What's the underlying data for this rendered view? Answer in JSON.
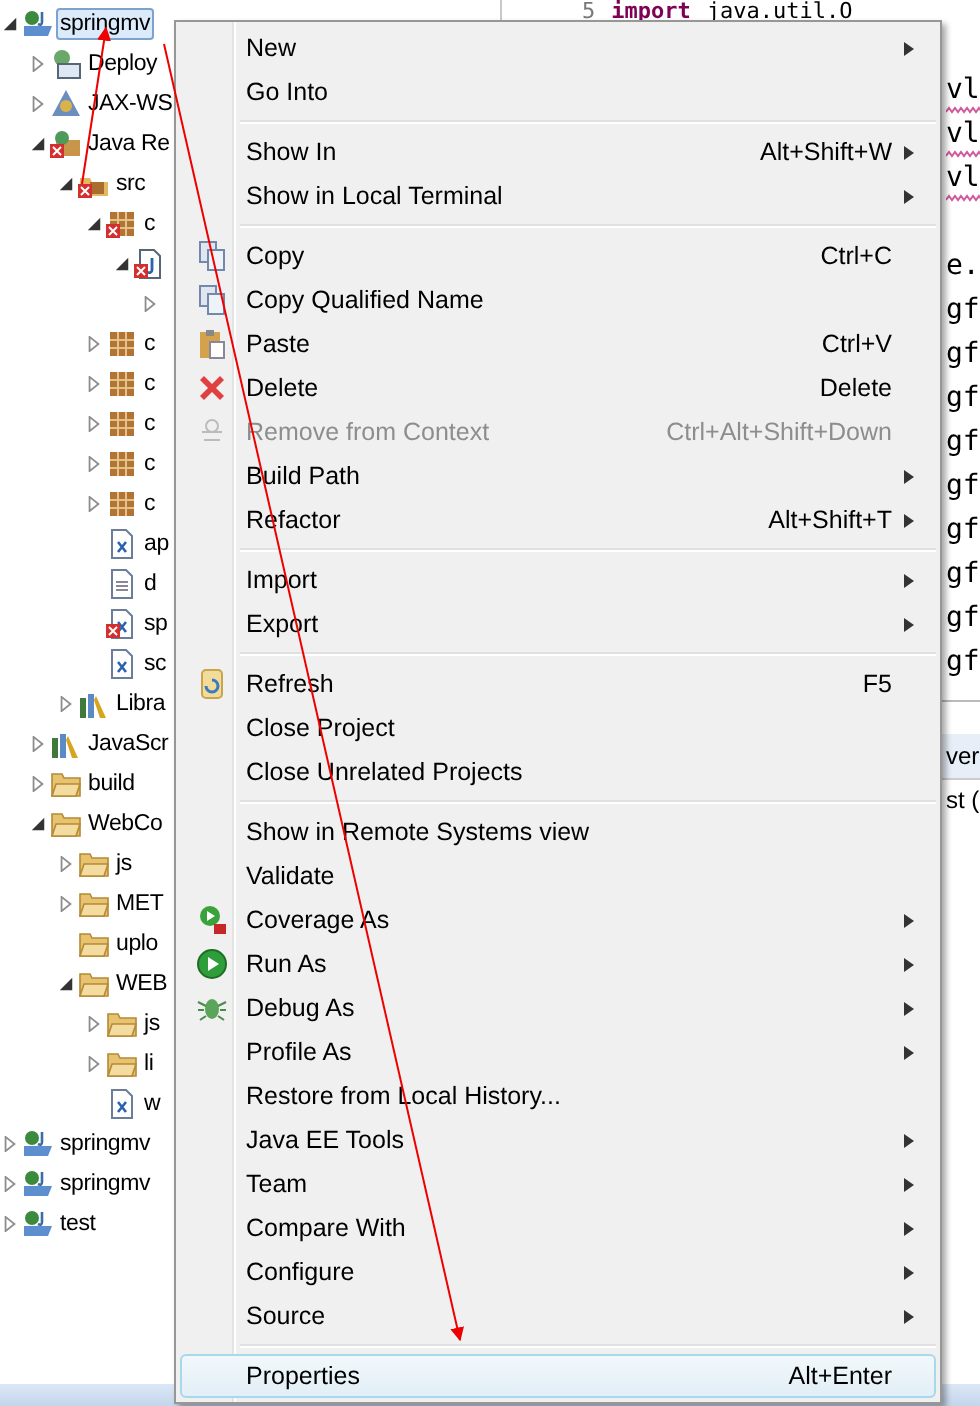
{
  "project_tree": [
    {
      "label": "springmv",
      "kind": "project",
      "selected": true,
      "expanded": true,
      "children": [
        {
          "label": "Deploy",
          "kind": "deploy",
          "selected": false,
          "expanded": false
        },
        {
          "label": "JAX-WS",
          "kind": "webservice",
          "selected": false,
          "expanded": false
        },
        {
          "label": "Java Re",
          "kind": "resources",
          "error": true,
          "selected": false,
          "expanded": true,
          "children": [
            {
              "label": "src",
              "kind": "source-folder",
              "error": true,
              "selected": false,
              "expanded": true,
              "children": [
                {
                  "label": "c",
                  "kind": "package",
                  "error": true,
                  "selected": false,
                  "expanded": true,
                  "children": [
                    {
                      "kind": "java",
                      "error": true,
                      "expanded": true,
                      "children": [
                        {
                          "expanded": false
                        }
                      ]
                    }
                  ]
                },
                {
                  "label": "c",
                  "kind": "package",
                  "selected": false,
                  "expanded": false
                },
                {
                  "label": "c",
                  "kind": "package",
                  "selected": false,
                  "expanded": false
                },
                {
                  "label": "c",
                  "kind": "package",
                  "selected": false,
                  "expanded": false
                },
                {
                  "label": "c",
                  "kind": "package",
                  "selected": false,
                  "expanded": false
                },
                {
                  "label": "c",
                  "kind": "package",
                  "selected": false,
                  "expanded": false
                },
                {
                  "label": "ap",
                  "kind": "xml",
                  "selected": false
                },
                {
                  "label": "d",
                  "kind": "file",
                  "selected": false
                },
                {
                  "label": "sp",
                  "kind": "xml",
                  "error": true,
                  "selected": false
                },
                {
                  "label": "sc",
                  "kind": "xml",
                  "selected": false
                }
              ]
            },
            {
              "label": "Libra",
              "kind": "library",
              "selected": false,
              "expanded": false
            }
          ]
        },
        {
          "label": "JavaScr",
          "kind": "library",
          "selected": false,
          "expanded": false
        },
        {
          "label": "build",
          "kind": "folder",
          "selected": false,
          "expanded": false
        },
        {
          "label": "WebCo",
          "kind": "folder",
          "selected": false,
          "expanded": true,
          "children": [
            {
              "label": "js",
              "kind": "folder",
              "selected": false,
              "expanded": false
            },
            {
              "label": "MET",
              "kind": "folder",
              "selected": false,
              "expanded": false
            },
            {
              "label": "uplo",
              "kind": "folder",
              "selected": false
            },
            {
              "label": "WEB",
              "kind": "folder",
              "selected": false,
              "expanded": true,
              "children": [
                {
                  "label": "js",
                  "kind": "folder",
                  "selected": false,
                  "expanded": false
                },
                {
                  "label": "li",
                  "kind": "folder",
                  "selected": false,
                  "expanded": false
                },
                {
                  "label": "w",
                  "kind": "xml",
                  "selected": false
                }
              ]
            }
          ]
        }
      ]
    },
    {
      "label": "springmv",
      "kind": "project",
      "selected": false,
      "expanded": false
    },
    {
      "label": "springmv",
      "kind": "project",
      "selected": false,
      "expanded": false
    },
    {
      "label": "test",
      "kind": "project",
      "selected": false,
      "expanded": false
    }
  ],
  "editor": {
    "top_line": {
      "number": "5",
      "keyword": "import",
      "text": "java.util.O"
    },
    "lines": [
      {
        "kind": "blank"
      },
      {
        "kind": "code",
        "text": "vl",
        "warning": true
      },
      {
        "kind": "code",
        "text": "vl",
        "warning": true
      },
      {
        "kind": "code",
        "text": "vl",
        "warning": true
      },
      {
        "kind": "blank"
      },
      {
        "kind": "code",
        "text": "e.",
        "warning": false
      },
      {
        "kind": "code",
        "text": "gf",
        "warning": false
      },
      {
        "kind": "code",
        "text": "gf",
        "warning": false
      },
      {
        "kind": "code",
        "text": "gf",
        "warning": false
      },
      {
        "kind": "code",
        "text": "gf",
        "warning": false
      },
      {
        "kind": "code",
        "text": "gf",
        "warning": false
      },
      {
        "kind": "code",
        "text": "gf",
        "warning": false
      },
      {
        "kind": "code",
        "text": "gf",
        "warning": false
      },
      {
        "kind": "code",
        "text": "gf",
        "warning": false
      },
      {
        "kind": "code",
        "text": "gf",
        "warning": false
      }
    ]
  },
  "bottom_panel": {
    "tabs": [
      {
        "label": "ver"
      }
    ],
    "rows": [
      "st ("
    ]
  },
  "context_menu": [
    {
      "kind": "plain",
      "label": "New",
      "submenu": true,
      "disabled": false,
      "selected": false
    },
    {
      "kind": "plain",
      "label": "Go Into",
      "submenu": false,
      "disabled": false,
      "selected": false
    },
    {
      "kind": "separator"
    },
    {
      "kind": "plain",
      "label": "Show In",
      "shortcut": "Alt+Shift+W",
      "submenu": true,
      "disabled": false,
      "selected": false
    },
    {
      "kind": "plain",
      "label": "Show in Local Terminal",
      "submenu": true,
      "disabled": false,
      "selected": false
    },
    {
      "kind": "separator"
    },
    {
      "kind": "copy",
      "label": "Copy",
      "shortcut": "Ctrl+C",
      "submenu": false,
      "disabled": false,
      "selected": false
    },
    {
      "kind": "copy",
      "label": "Copy Qualified Name",
      "submenu": false,
      "disabled": false,
      "selected": false
    },
    {
      "kind": "paste",
      "label": "Paste",
      "shortcut": "Ctrl+V",
      "submenu": false,
      "disabled": false,
      "selected": false
    },
    {
      "kind": "delete",
      "label": "Delete",
      "shortcut": "Delete",
      "submenu": false,
      "disabled": false,
      "selected": false
    },
    {
      "kind": "remove",
      "label": "Remove from Context",
      "shortcut": "Ctrl+Alt+Shift+Down",
      "submenu": false,
      "disabled": true,
      "selected": false
    },
    {
      "kind": "plain",
      "label": "Build Path",
      "submenu": true,
      "disabled": false,
      "selected": false
    },
    {
      "kind": "plain",
      "label": "Refactor",
      "shortcut": "Alt+Shift+T",
      "submenu": true,
      "disabled": false,
      "selected": false
    },
    {
      "kind": "separator"
    },
    {
      "kind": "plain",
      "label": "Import",
      "submenu": true,
      "disabled": false,
      "selected": false
    },
    {
      "kind": "plain",
      "label": "Export",
      "submenu": true,
      "disabled": false,
      "selected": false
    },
    {
      "kind": "separator"
    },
    {
      "kind": "refresh",
      "label": "Refresh",
      "shortcut": "F5",
      "submenu": false,
      "disabled": false,
      "selected": false
    },
    {
      "kind": "plain",
      "label": "Close Project",
      "submenu": false,
      "disabled": false,
      "selected": false
    },
    {
      "kind": "plain",
      "label": "Close Unrelated Projects",
      "submenu": false,
      "disabled": false,
      "selected": false
    },
    {
      "kind": "separator"
    },
    {
      "kind": "plain",
      "label": "Show in Remote Systems view",
      "submenu": false,
      "disabled": false,
      "selected": false
    },
    {
      "kind": "plain",
      "label": "Validate",
      "submenu": false,
      "disabled": false,
      "selected": false
    },
    {
      "kind": "coverage",
      "label": "Coverage As",
      "submenu": true,
      "disabled": false,
      "selected": false
    },
    {
      "kind": "run",
      "label": "Run As",
      "submenu": true,
      "disabled": false,
      "selected": false
    },
    {
      "kind": "debug",
      "label": "Debug As",
      "submenu": true,
      "disabled": false,
      "selected": false
    },
    {
      "kind": "plain",
      "label": "Profile As",
      "submenu": true,
      "disabled": false,
      "selected": false
    },
    {
      "kind": "plain",
      "label": "Restore from Local History...",
      "submenu": false,
      "disabled": false,
      "selected": false
    },
    {
      "kind": "plain",
      "label": "Java EE Tools",
      "submenu": true,
      "disabled": false,
      "selected": false
    },
    {
      "kind": "plain",
      "label": "Team",
      "submenu": true,
      "disabled": false,
      "selected": false
    },
    {
      "kind": "plain",
      "label": "Compare With",
      "submenu": true,
      "disabled": false,
      "selected": false
    },
    {
      "kind": "plain",
      "label": "Configure",
      "submenu": true,
      "disabled": false,
      "selected": false
    },
    {
      "kind": "plain",
      "label": "Source",
      "submenu": true,
      "disabled": false,
      "selected": false
    },
    {
      "kind": "separator"
    },
    {
      "kind": "plain",
      "label": "Properties",
      "shortcut": "Alt+Enter",
      "submenu": false,
      "disabled": false,
      "selected": true
    }
  ]
}
